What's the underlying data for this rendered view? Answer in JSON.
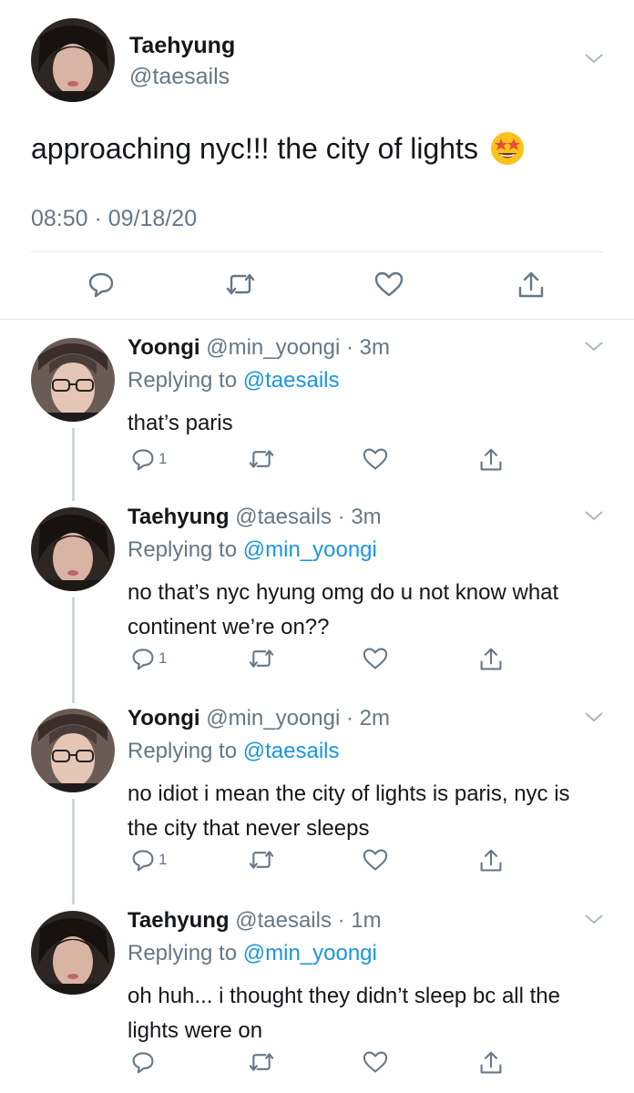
{
  "main_tweet": {
    "name": "Taehyung",
    "handle": "@taesails",
    "text": "approaching nyc!!! the city of lights",
    "emoji": "star-struck-emoji",
    "timestamp": "08:50 · 09/18/20",
    "actions": [
      "reply-icon",
      "retweet-icon",
      "like-icon",
      "share-icon"
    ]
  },
  "replies": [
    {
      "name": "Yoongi",
      "handle": "@min_yoongi",
      "time": "· 3m",
      "replying_prefix": "Replying to ",
      "replying_to": "@taesails",
      "text": "that’s paris",
      "reply_count": "1"
    },
    {
      "name": "Taehyung",
      "handle": "@taesails",
      "time": "· 3m",
      "replying_prefix": "Replying to ",
      "replying_to": "@min_yoongi",
      "text": "no that’s nyc hyung omg do u not know what continent we’re on??",
      "reply_count": "1"
    },
    {
      "name": "Yoongi",
      "handle": "@min_yoongi",
      "time": "· 2m",
      "replying_prefix": "Replying to ",
      "replying_to": "@taesails",
      "text": "no idiot i mean the city of lights is paris, nyc is the city that never sleeps",
      "reply_count": "1"
    },
    {
      "name": "Taehyung",
      "handle": "@taesails",
      "time": "· 1m",
      "replying_prefix": "Replying to ",
      "replying_to": "@min_yoongi",
      "text": "oh huh... i thought they didn’t sleep bc all the lights were on",
      "reply_count": ""
    }
  ],
  "colors": {
    "link": "#1b95e0",
    "muted": "#657786",
    "divider": "#e1e8ed"
  }
}
